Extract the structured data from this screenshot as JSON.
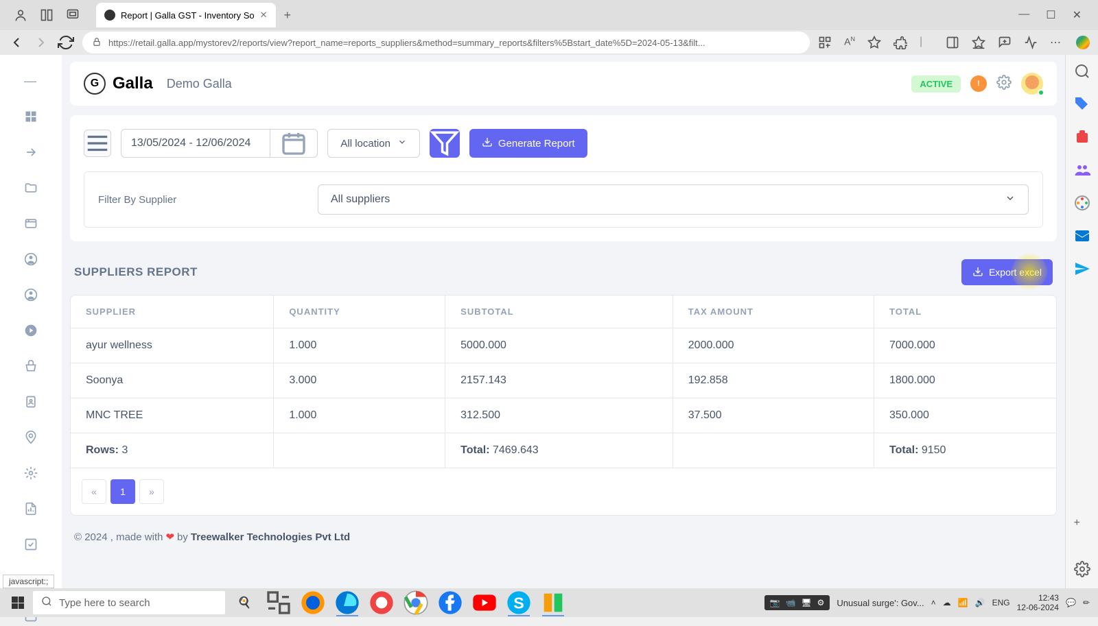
{
  "browser": {
    "tab_title": "Report | Galla GST - Inventory So",
    "url": "https://retail.galla.app/mystorev2/reports/view?report_name=reports_suppliers&method=summary_reports&filters%5Bstart_date%5D=2024-05-13&filt..."
  },
  "header": {
    "logo_text": "Galla",
    "store_name": "Demo Galla",
    "status": "ACTIVE",
    "notification_count": "!"
  },
  "controls": {
    "date_range": "13/05/2024 - 12/06/2024",
    "location": "All location",
    "generate_label": "Generate Report",
    "filter_label": "Filter By Supplier",
    "supplier_filter": "All suppliers"
  },
  "report": {
    "title": "SUPPLIERS REPORT",
    "export_label": "Export excel",
    "columns": [
      "SUPPLIER",
      "QUANTITY",
      "SUBTOTAL",
      "TAX AMOUNT",
      "TOTAL"
    ],
    "rows": [
      {
        "supplier": "ayur wellness",
        "quantity": "1.000",
        "subtotal": "5000.000",
        "tax": "2000.000",
        "total": "7000.000"
      },
      {
        "supplier": "Soonya",
        "quantity": "3.000",
        "subtotal": "2157.143",
        "tax": "192.858",
        "total": "1800.000"
      },
      {
        "supplier": "MNC TREE",
        "quantity": "1.000",
        "subtotal": "312.500",
        "tax": "37.500",
        "total": "350.000"
      }
    ],
    "summary": {
      "rows_label": "Rows:",
      "rows_count": "3",
      "total_label": "Total:",
      "subtotal_sum": "7469.643",
      "grand_total": "9150"
    },
    "pagination": {
      "prev": "«",
      "current": "1",
      "next": "»"
    }
  },
  "footer": {
    "copyright": "© 2024 , made with",
    "by": "by",
    "company": "Treewalker Technologies Pvt Ltd"
  },
  "status_hover": "javascript:;",
  "taskbar": {
    "search_placeholder": "Type here to search",
    "news": "Unusual surge': Gov...",
    "lang": "ENG",
    "time": "12:43",
    "date": "12-06-2024"
  }
}
